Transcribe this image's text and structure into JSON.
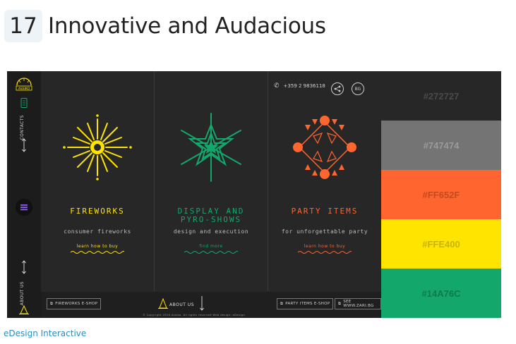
{
  "heading": {
    "number": "17",
    "title": "Innovative and Audacious"
  },
  "site": {
    "logo_text": "ASSIKO",
    "side_labels": {
      "contacts": "CONTACTS",
      "about": "ABOUT US"
    },
    "phone": "+359 2 9836118",
    "language": "BG",
    "panels": [
      {
        "title_line1": "FIREWORKS",
        "title_line2": "",
        "subtitle": "consumer fireworks",
        "link": "learn how to buy",
        "color": "#FFE400"
      },
      {
        "title_line1": "DISPLAY AND",
        "title_line2": "PYRO-SHOWS",
        "subtitle": "design and execution",
        "link": "find more",
        "color": "#14A76C"
      },
      {
        "title_line1": "PARTY ITEMS",
        "title_line2": "",
        "subtitle": "for unforgettable party",
        "link": "learn how to buy",
        "color": "#FF652F"
      }
    ],
    "bottom": {
      "fireworks_shop": "FIREWORKS E-SHOP",
      "about": "ABOUT US",
      "party_shop": "PARTY ITEMS E-SHOP",
      "zari": "SEE WWW.ZARI.BG",
      "copyright": "© Copyright 2016 Assiko. All rights reserved     Web design: eDesign"
    }
  },
  "palette": [
    {
      "hex": "#272727",
      "bg": "#272727",
      "fg": "#4a4a4a"
    },
    {
      "hex": "#747474",
      "bg": "#747474",
      "fg": "#9a9a9a"
    },
    {
      "hex": "#FF652F",
      "bg": "#FF652F",
      "fg": "#c44a1f"
    },
    {
      "hex": "#FFE400",
      "bg": "#FFE400",
      "fg": "#c9b400"
    },
    {
      "hex": "#14A76C",
      "bg": "#14A76C",
      "fg": "#0d7a4e"
    }
  ],
  "caption": "eDesign Interactive"
}
